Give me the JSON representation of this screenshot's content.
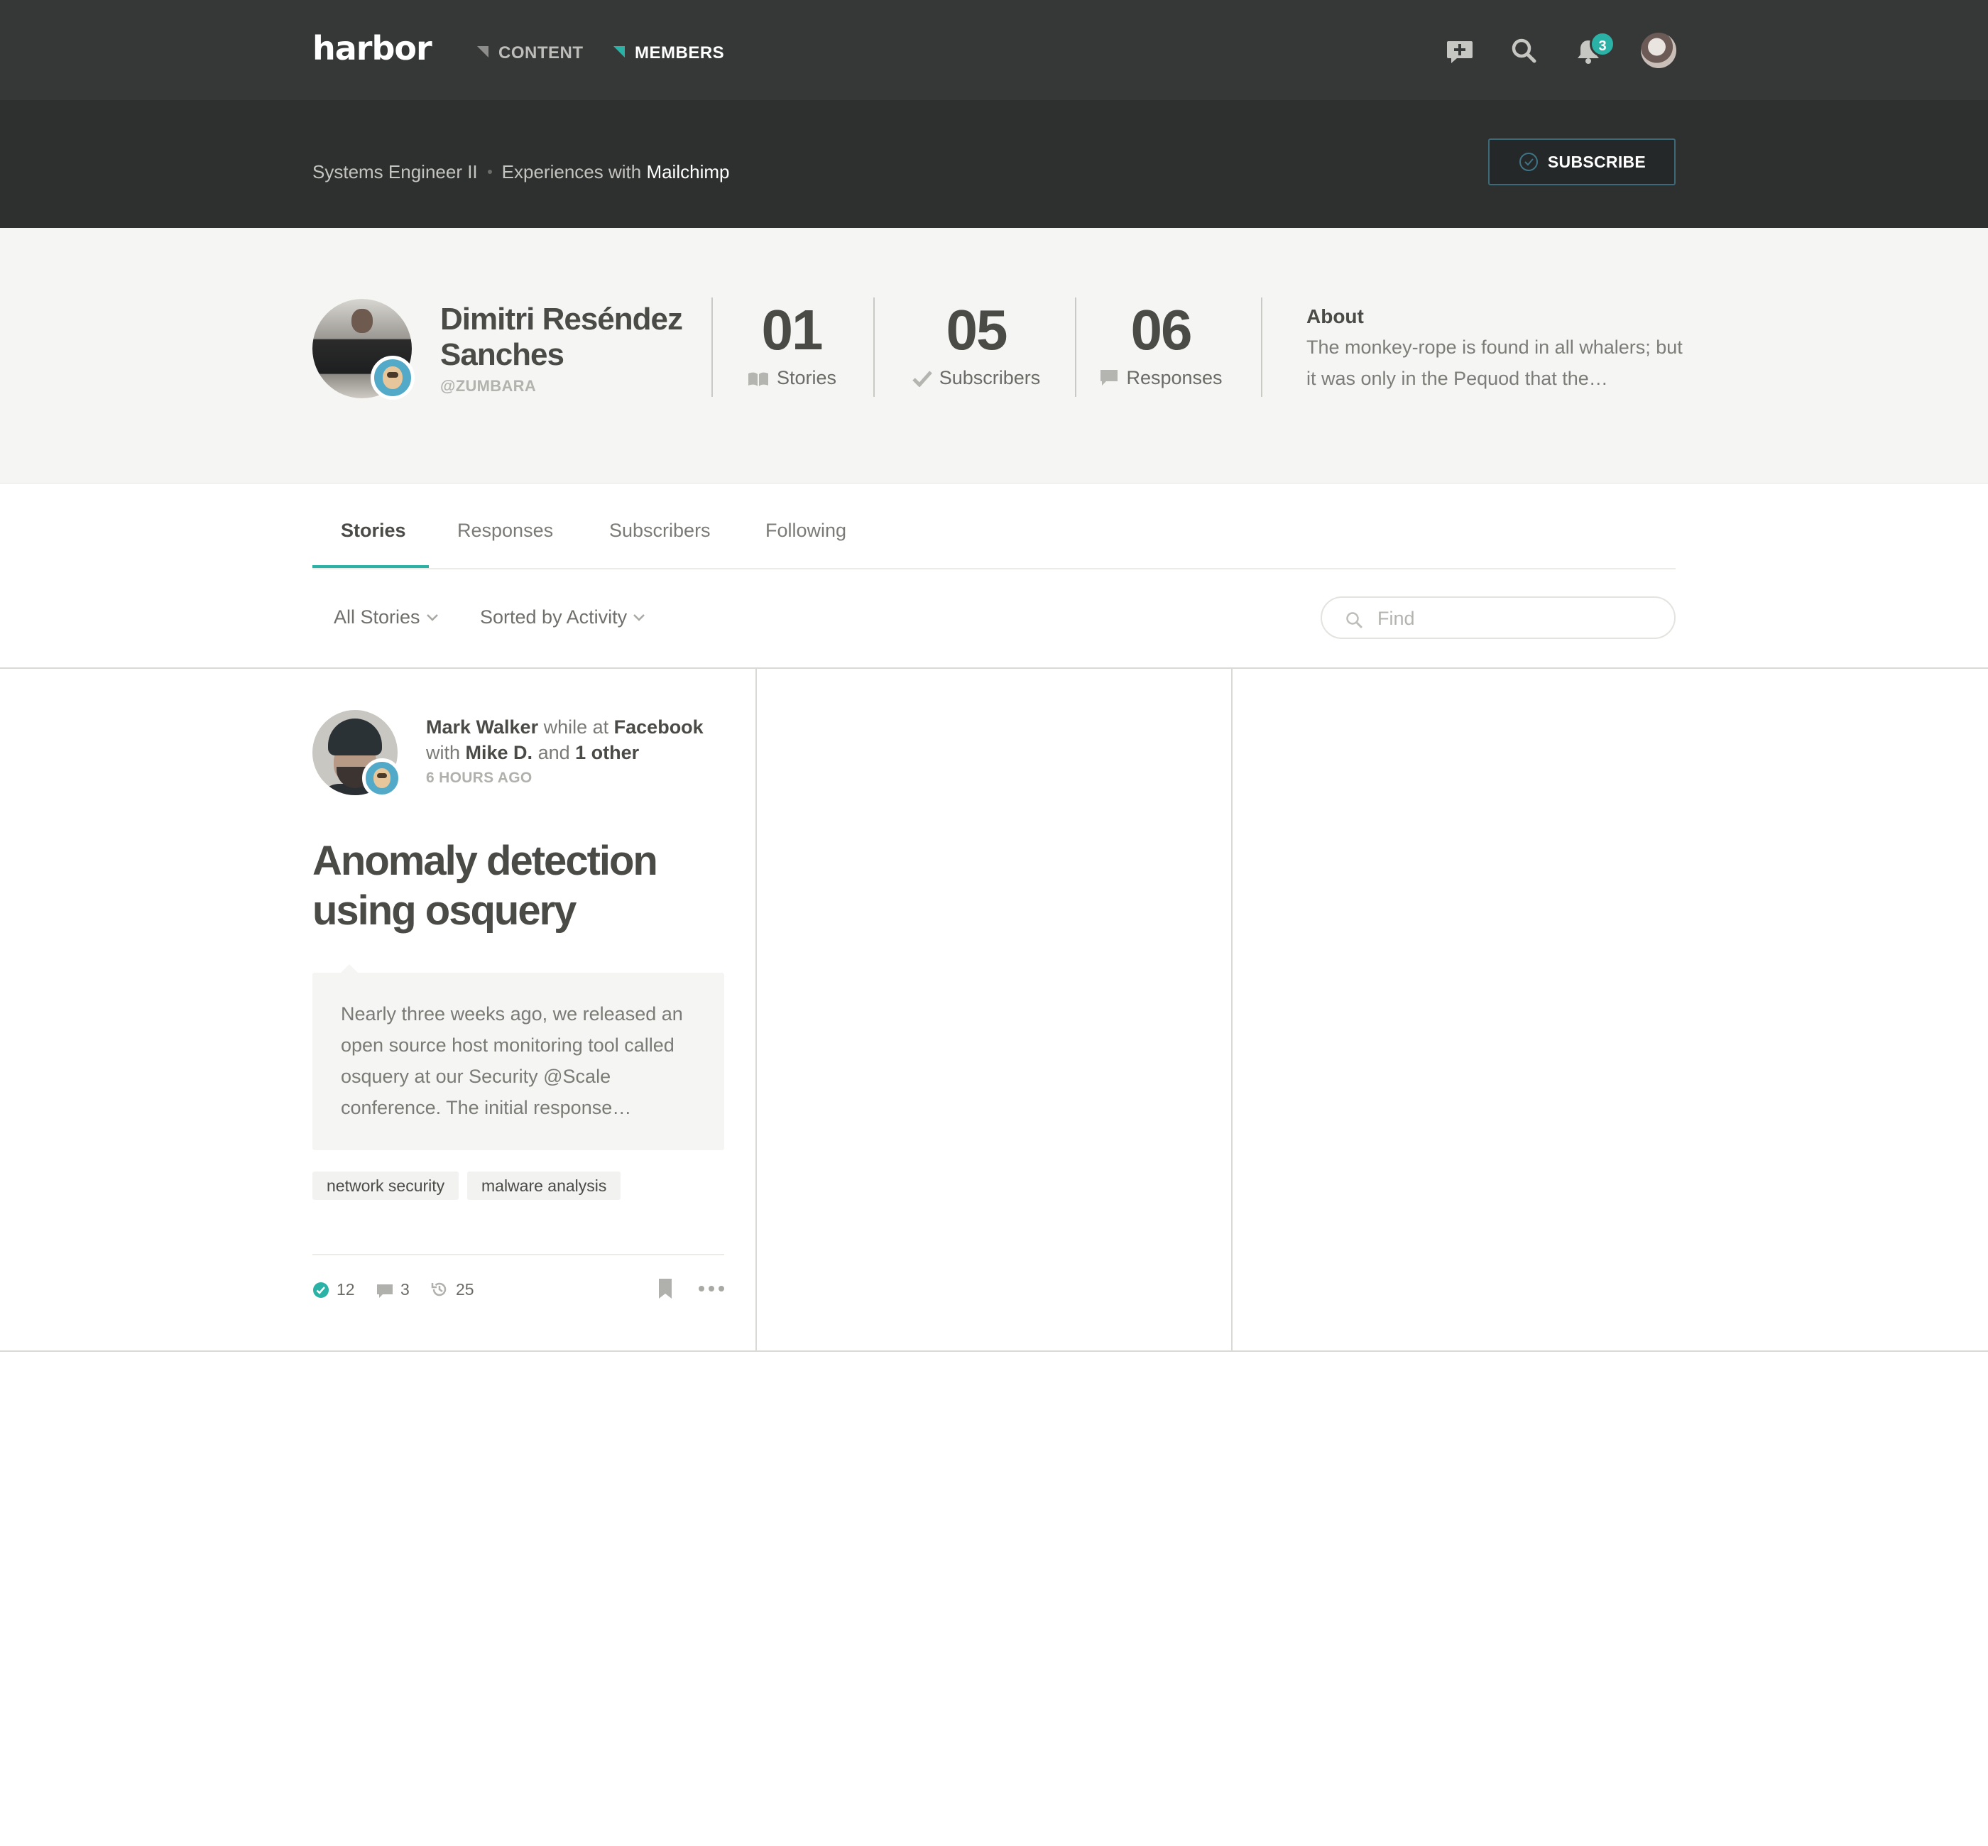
{
  "nav": {
    "logo": "harbor",
    "links": [
      {
        "label": "CONTENT",
        "active": false
      },
      {
        "label": "MEMBERS",
        "active": true
      }
    ],
    "notification_count": "3",
    "icons": [
      "compose-icon",
      "search-icon",
      "bell-icon",
      "user-avatar"
    ]
  },
  "subheader": {
    "crumb_role": "Systems Engineer II",
    "crumb_prefix": "Experiences with",
    "crumb_company": "Mailchimp",
    "subscribe_label": "SUBSCRIBE"
  },
  "profile": {
    "name": "Dimitri Reséndez Sanches",
    "handle": "@ZUMBARA",
    "stats": {
      "stories": {
        "value": "01",
        "label": "Stories"
      },
      "subscribers": {
        "value": "05",
        "label": "Subscribers"
      },
      "responses": {
        "value": "06",
        "label": "Responses"
      }
    },
    "about_heading": "About",
    "about_text": "The monkey-rope is found in all whalers; but it was only in the Pequod that the…"
  },
  "tabs": {
    "stories": "Stories",
    "responses": "Responses",
    "subscribers": "Subscribers",
    "following": "Following",
    "active": "Stories"
  },
  "filters": {
    "scope": "All Stories",
    "sort": "Sorted by Activity",
    "search_placeholder": "Find"
  },
  "story": {
    "author": "Mark Walker",
    "while_at": "while at",
    "company": "Facebook",
    "with": "with",
    "coauthor": "Mike D.",
    "and": "and",
    "others": "1 other",
    "time": "6 HOURS AGO",
    "title": "Anomaly detection using osquery",
    "excerpt": "Nearly three weeks ago, we released an open source host monitoring tool called osquery at our Security @Scale conference. The initial response…",
    "tags": [
      "network security",
      "malware analysis"
    ],
    "likes": "12",
    "comments": "3",
    "views": "25"
  },
  "colors": {
    "accent": "#2ab2a6",
    "nav_bg": "#363838",
    "subheader_bg": "#2e3030",
    "profile_bg": "#f5f5f3",
    "text_dark": "#4a4a47"
  }
}
